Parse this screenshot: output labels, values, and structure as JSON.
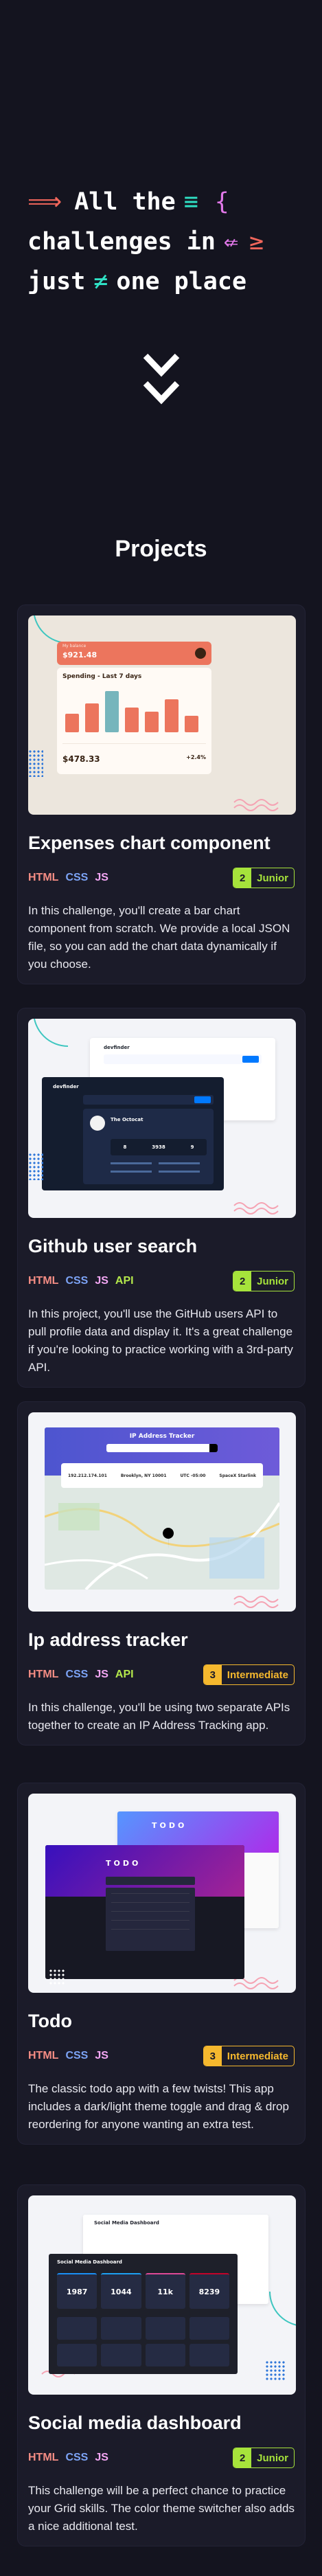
{
  "hero": {
    "line1_word": "All the",
    "line2_word": "challenges in",
    "line3_word1": "just",
    "line3_word2": "one place",
    "arrow": "⟹",
    "triple_eq": "≡",
    "brace": "{",
    "not_leftarrow": "⇍",
    "gte": "≥",
    "not_eq": "≠"
  },
  "projects_title": "Projects",
  "projects": [
    {
      "title": "Expenses chart component",
      "tags": [
        "HTML",
        "CSS",
        "JS"
      ],
      "level_num": "2",
      "level": "Junior",
      "description": "In this challenge, you'll create a bar chart component from scratch. We provide a local JSON file, so you can add the chart data dynamically if you choose.",
      "preview": {
        "balance_label": "My balance",
        "balance": "$921.48",
        "heading": "Spending - Last 7 days",
        "total": "$478.33",
        "change": "+2.4%"
      }
    },
    {
      "title": "Github user search",
      "tags": [
        "HTML",
        "CSS",
        "JS",
        "API"
      ],
      "level_num": "2",
      "level": "Junior",
      "description": "In this project, you'll use the GitHub users API to pull profile data and display it. It's a great challenge if you're looking to practice working with a 3rd-party API.",
      "preview": {
        "app_name": "devfinder",
        "user": "The Octocat",
        "stats": [
          "8",
          "3938",
          "9"
        ]
      }
    },
    {
      "title": "Ip address tracker",
      "tags": [
        "HTML",
        "CSS",
        "JS",
        "API"
      ],
      "level_num": "3",
      "level": "Intermediate",
      "description": "In this challenge, you'll be using two separate APIs together to create an IP Address Tracking app.",
      "preview": {
        "heading": "IP Address Tracker",
        "ip": "192.212.174.101",
        "location": "Brooklyn, NY 10001",
        "timezone": "UTC -05:00",
        "isp": "SpaceX Starlink"
      }
    },
    {
      "title": "Todo",
      "tags": [
        "HTML",
        "CSS",
        "JS"
      ],
      "level_num": "3",
      "level": "Intermediate",
      "description": "The classic todo app with a few twists! This app includes a dark/light theme toggle and drag & drop reordering for anyone wanting an extra test.",
      "preview": {
        "heading": "TODO"
      }
    },
    {
      "title": "Social media dashboard",
      "tags": [
        "HTML",
        "CSS",
        "JS"
      ],
      "level_num": "2",
      "level": "Junior",
      "description": "This challenge will be a perfect chance to practice your Grid skills. The color theme switcher also adds a nice additional test.",
      "preview": {
        "heading": "Social Media Dashboard",
        "stats": [
          "1987",
          "1044",
          "11k",
          "8239"
        ]
      }
    }
  ],
  "colors": {
    "background": "#14141f",
    "card": "#1b1b29",
    "html": "#f58d84",
    "css": "#7ca3f5",
    "js": "#f4a7f4",
    "api": "#b4e84b",
    "junior": "#a6e33b",
    "intermediate": "#f5b82e"
  }
}
